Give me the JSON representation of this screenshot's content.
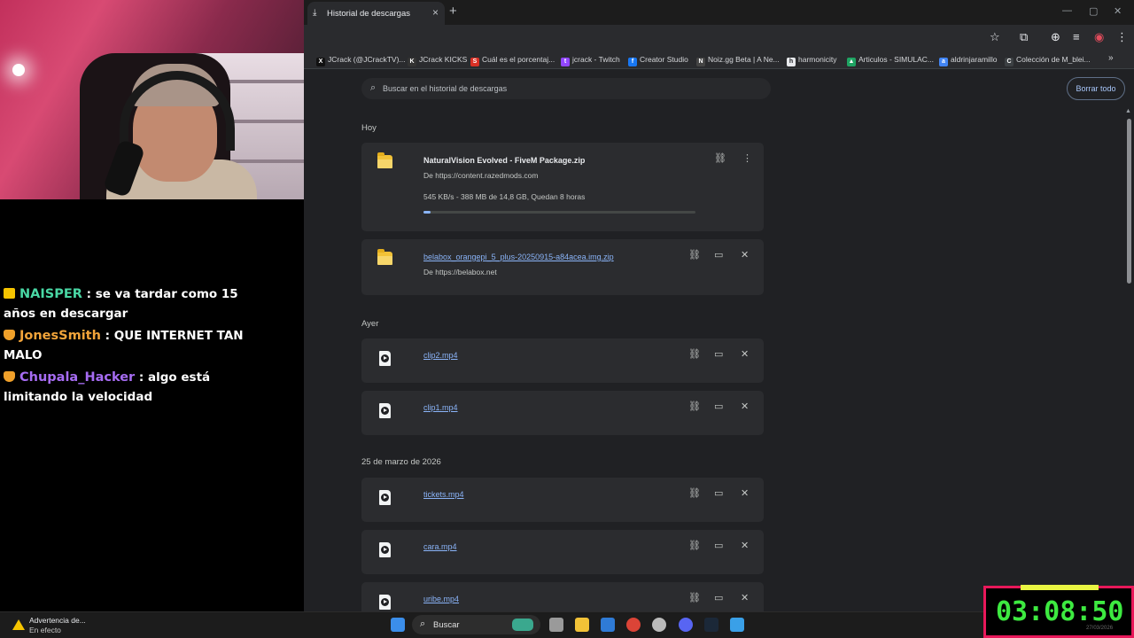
{
  "chat": [
    {
      "badge": "crown",
      "user": "NAISPER",
      "color": "#49d7a4",
      "text": ": se va tardar como 15 años en descargar"
    },
    {
      "badge": "shield",
      "user": "JonesSmith",
      "color": "#f2a43a",
      "text": ": QUE INTERNET TAN MALO"
    },
    {
      "badge": "shield",
      "user": "Chupala_Hacker",
      "color": "#a66cf2",
      "text": ": algo está limitando la velocidad"
    }
  ],
  "browser": {
    "tab_title": "Historial de descargas",
    "bookmarks": [
      {
        "label": "JCrack (@JCrackTV)...",
        "icon": "x-icon",
        "color": "#111111",
        "glyph": "X"
      },
      {
        "label": "JCrack KICKS",
        "icon": "kick-icon",
        "color": "#333333",
        "glyph": "K"
      },
      {
        "label": "Cuál es el porcentaj...",
        "icon": "s-icon",
        "color": "#d93025",
        "glyph": "S"
      },
      {
        "label": "jcrack - Twitch",
        "icon": "twitch-icon",
        "color": "#9146ff",
        "glyph": "t"
      },
      {
        "label": "Creator Studio",
        "icon": "facebook-icon",
        "color": "#1877f2",
        "glyph": "f"
      },
      {
        "label": "Noiz.gg Beta | A Ne...",
        "icon": "noiz-icon",
        "color": "#444444",
        "glyph": "N"
      },
      {
        "label": "harmonicity",
        "icon": "harmonicity-icon",
        "color": "#e8eaed",
        "glyph": "h"
      },
      {
        "label": "Articulos - SIMULAC...",
        "icon": "drive-icon",
        "color": "#1fa463",
        "glyph": "▲"
      },
      {
        "label": "aldrinjaramillo",
        "icon": "doc-icon",
        "color": "#4285f4",
        "glyph": "a"
      },
      {
        "label": "Colección de M_blei...",
        "icon": "collection-icon",
        "color": "#3c4043",
        "glyph": "C"
      }
    ],
    "search_placeholder": "Buscar en el historial de descargas",
    "clear_all": "Borrar todo",
    "groups": [
      {
        "date": "Hoy",
        "items": [
          {
            "file": "NaturalVision Evolved - FiveM Package.zip",
            "source": "De https://content.razedmods.com",
            "type": "zip",
            "status": "in-progress",
            "progress_text": "545 KB/s - 388 MB de 14,8 GB, Quedan 8 horas",
            "progress": 0.026
          },
          {
            "file": "belabox_orangepi_5_plus-20250915-a84acea.img.zip",
            "source": "De https://belabox.net",
            "type": "zip",
            "status": "complete"
          }
        ]
      },
      {
        "date": "Ayer",
        "items": [
          {
            "file": "clip2.mp4",
            "type": "video",
            "status": "complete"
          },
          {
            "file": "clip1.mp4",
            "type": "video",
            "status": "complete"
          }
        ]
      },
      {
        "date": "25 de marzo de 2026",
        "items": [
          {
            "file": "tickets.mp4",
            "type": "video",
            "status": "complete"
          },
          {
            "file": "cara.mp4",
            "type": "video",
            "status": "complete"
          },
          {
            "file": "uribe.mp4",
            "type": "video",
            "status": "complete"
          }
        ]
      }
    ]
  },
  "taskbar": {
    "notification_title": "Advertencia de...",
    "notification_sub": "En efecto",
    "search_label": "Buscar",
    "apps": [
      {
        "name": "windows-start-icon",
        "color": "#3b8eea"
      },
      {
        "name": "task-view-icon",
        "color": "#9a9a9a"
      },
      {
        "name": "file-explorer-icon",
        "color": "#f2c237"
      },
      {
        "name": "mail-icon",
        "color": "#2f7bd6"
      },
      {
        "name": "chrome-icon",
        "color": "#db4437"
      },
      {
        "name": "app-icon",
        "color": "#bbbbbb"
      },
      {
        "name": "discord-icon",
        "color": "#5865f2"
      },
      {
        "name": "steam-icon",
        "color": "#1b2838"
      },
      {
        "name": "photos-icon",
        "color": "#3aa0e8"
      }
    ]
  },
  "clock": {
    "time": "03:08:50",
    "date": "27/03/2026"
  }
}
